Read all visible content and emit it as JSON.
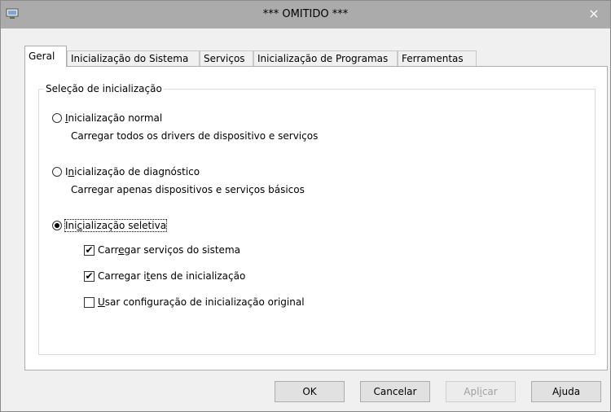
{
  "window": {
    "title": "*** OMITIDO ***",
    "close_glyph": "×",
    "icon": "msconfig-icon"
  },
  "tabs": [
    {
      "label": "Geral",
      "active": true
    },
    {
      "label": "Inicialização do Sistema"
    },
    {
      "label": "Serviços"
    },
    {
      "label": "Inicialização de Programas"
    },
    {
      "label": "Ferramentas"
    }
  ],
  "startup_group": {
    "legend": "Seleção de inicialização",
    "options": [
      {
        "label_pre": "",
        "mnemonic": "I",
        "label_post": "nicialização normal",
        "description": "Carregar todos os drivers de dispositivo e serviços",
        "selected": false
      },
      {
        "label_pre": "I",
        "mnemonic": "n",
        "label_post": "icialização de diagnóstico",
        "description": "Carregar apenas dispositivos e serviços básicos",
        "selected": false
      },
      {
        "label_pre": "Ini",
        "mnemonic": "c",
        "label_post": "ialização seletiva",
        "selected": true
      }
    ],
    "checkboxes": [
      {
        "label_pre": "Carr",
        "mnemonic": "e",
        "label_post": "gar serviços do sistema",
        "checked": true
      },
      {
        "label_pre": "Carregar i",
        "mnemonic": "t",
        "label_post": "ens de inicialização",
        "checked": true
      },
      {
        "label_pre": "",
        "mnemonic": "U",
        "label_post": "sar configuração de inicialização original",
        "checked": false
      }
    ],
    "check_glyph": "✔"
  },
  "buttons": {
    "ok": "OK",
    "cancel": "Cancelar",
    "apply_pre": "Apl",
    "apply_mnemonic": "i",
    "apply_post": "car",
    "help": "Ajuda"
  }
}
